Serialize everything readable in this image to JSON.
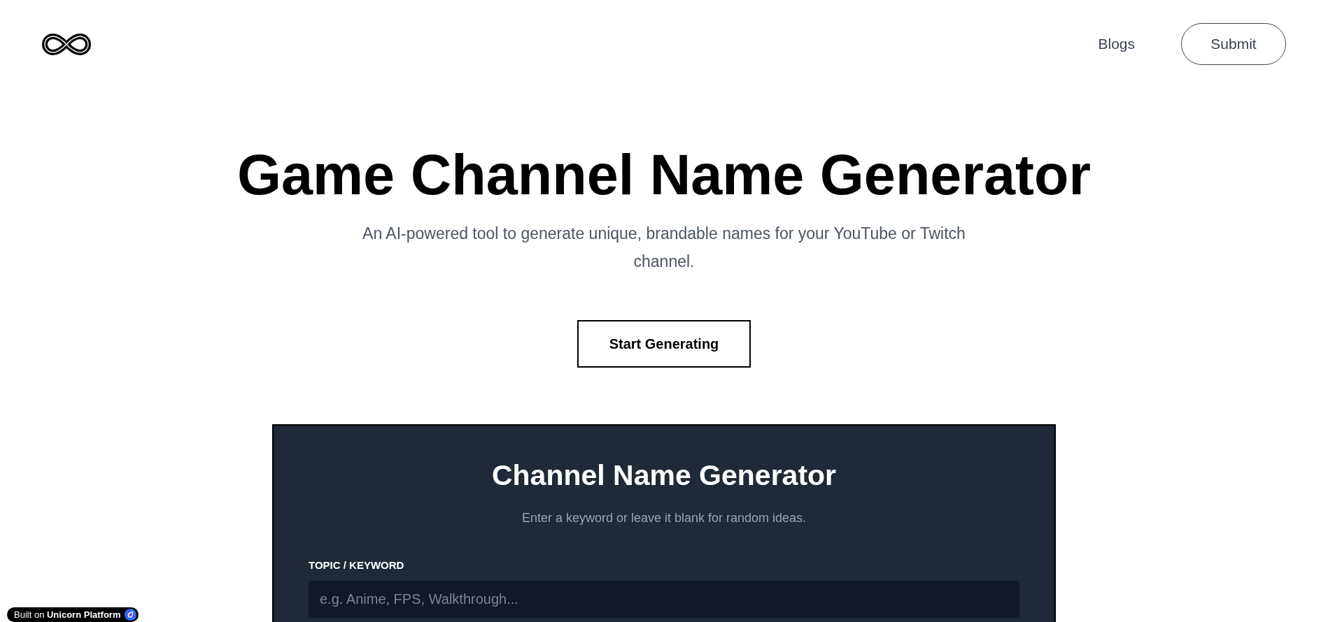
{
  "header": {
    "nav_links": [
      "Blogs"
    ],
    "submit_button": "Submit"
  },
  "hero": {
    "title": "Game Channel Name Generator",
    "subtitle": "An AI-powered tool to generate unique, brandable names for your YouTube or Twitch channel.",
    "cta_button": "Start Generating"
  },
  "generator_card": {
    "title": "Channel Name Generator",
    "subtitle": "Enter a keyword or leave it blank for random ideas.",
    "field": {
      "label": "TOPIC / KEYWORD",
      "placeholder": "e.g. Anime, FPS, Walkthrough..."
    }
  },
  "badge": {
    "text": "Built on **Unicorn Platform**"
  }
}
